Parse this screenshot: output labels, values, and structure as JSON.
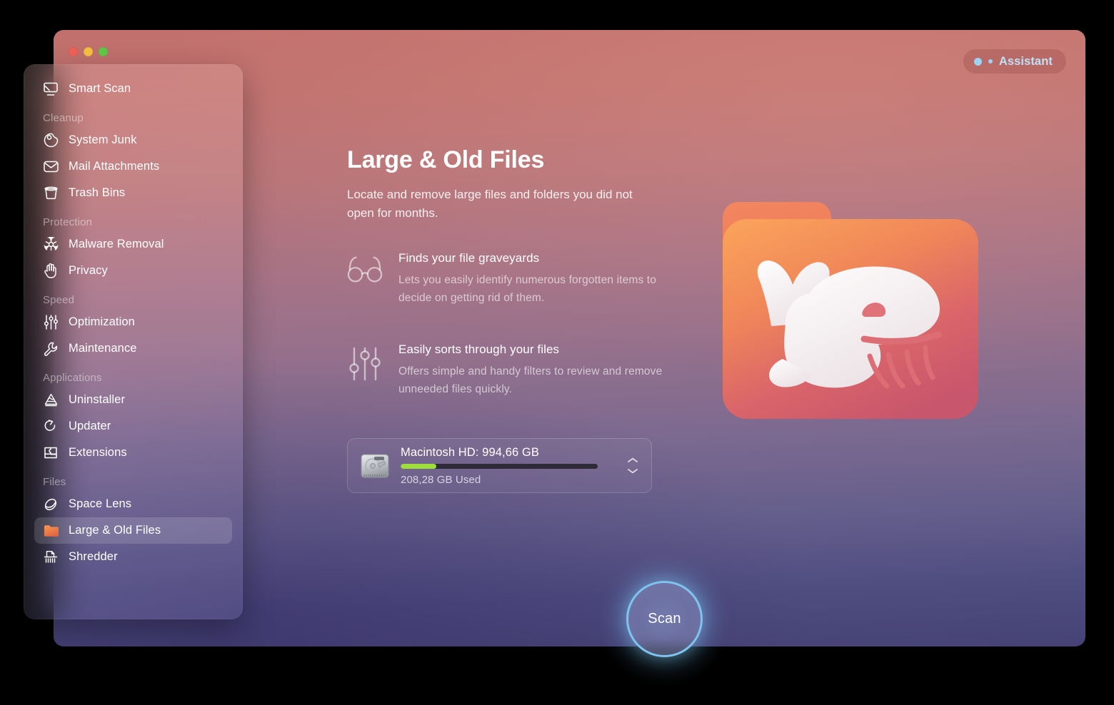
{
  "window": {
    "traffic_lights": [
      "close",
      "minimize",
      "zoom"
    ],
    "assistant": {
      "label": "Assistant"
    }
  },
  "sidebar": {
    "groups": [
      {
        "title": null,
        "items": [
          {
            "label": "Smart Scan",
            "icon": "smart-scan-icon",
            "selected": false
          }
        ]
      },
      {
        "title": "Cleanup",
        "items": [
          {
            "label": "System Junk",
            "icon": "system-junk-icon",
            "selected": false
          },
          {
            "label": "Mail Attachments",
            "icon": "mail-icon",
            "selected": false
          },
          {
            "label": "Trash Bins",
            "icon": "trash-icon",
            "selected": false
          }
        ]
      },
      {
        "title": "Protection",
        "items": [
          {
            "label": "Malware Removal",
            "icon": "biohazard-icon",
            "selected": false
          },
          {
            "label": "Privacy",
            "icon": "hand-icon",
            "selected": false
          }
        ]
      },
      {
        "title": "Speed",
        "items": [
          {
            "label": "Optimization",
            "icon": "sliders-icon",
            "selected": false
          },
          {
            "label": "Maintenance",
            "icon": "wrench-icon",
            "selected": false
          }
        ]
      },
      {
        "title": "Applications",
        "items": [
          {
            "label": "Uninstaller",
            "icon": "uninstaller-icon",
            "selected": false
          },
          {
            "label": "Updater",
            "icon": "updater-icon",
            "selected": false
          },
          {
            "label": "Extensions",
            "icon": "extensions-icon",
            "selected": false
          }
        ]
      },
      {
        "title": "Files",
        "items": [
          {
            "label": "Space Lens",
            "icon": "space-lens-icon",
            "selected": false
          },
          {
            "label": "Large & Old Files",
            "icon": "orange-folder-icon",
            "selected": true
          },
          {
            "label": "Shredder",
            "icon": "shredder-icon",
            "selected": false
          }
        ]
      }
    ]
  },
  "main": {
    "title": "Large & Old Files",
    "subtitle": "Locate and remove large files and folders you did not open for months.",
    "features": [
      {
        "icon": "glasses-icon",
        "title": "Finds your file graveyards",
        "description": "Lets you easily identify numerous forgotten items to decide on getting rid of them."
      },
      {
        "icon": "sliders-icon",
        "title": "Easily sorts through your files",
        "description": "Offers simple and handy filters to review and remove unneeded files quickly."
      }
    ],
    "disk": {
      "icon": "hard-disk-icon",
      "name": "Macintosh HD: 994,66 GB",
      "used_label": "208,28 GB Used",
      "used_percent": 18,
      "stepper_icon": "chevron-up-down-icon"
    },
    "hero_icon": "whale-folder-icon",
    "scan_button": {
      "label": "Scan"
    }
  },
  "colors": {
    "accent_blue": "#7ec4ef",
    "progress_green": "#9ede3c",
    "folder_orange": "#f08a4b",
    "bg_top": "#c2706d",
    "bg_bottom": "#464274"
  }
}
